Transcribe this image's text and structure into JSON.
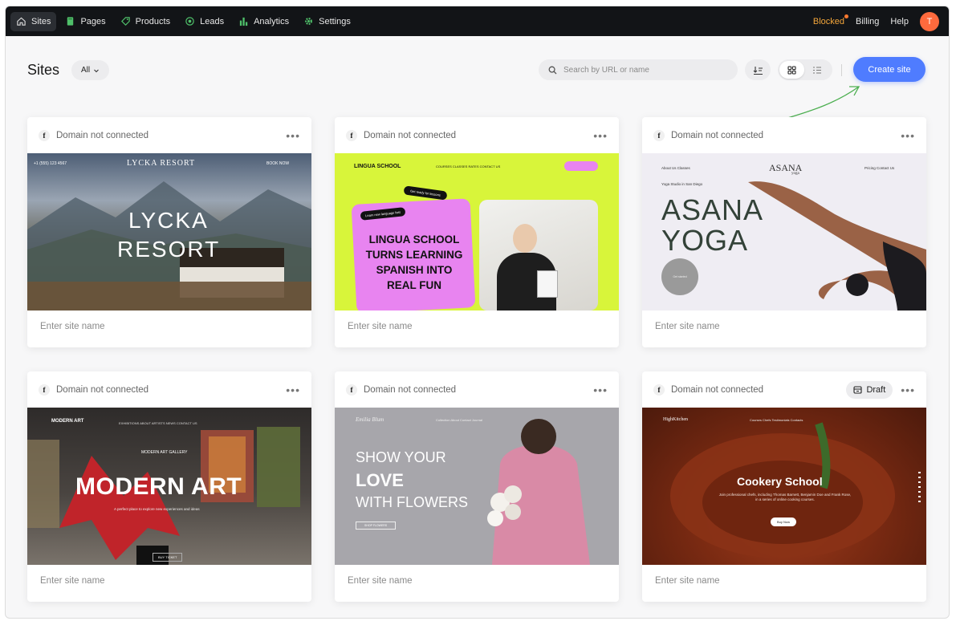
{
  "topbar": {
    "nav": [
      {
        "label": "Sites",
        "icon": "home-icon",
        "active": true
      },
      {
        "label": "Pages",
        "icon": "pages-icon"
      },
      {
        "label": "Products",
        "icon": "tag-icon"
      },
      {
        "label": "Leads",
        "icon": "target-icon"
      },
      {
        "label": "Analytics",
        "icon": "bar-chart-icon"
      },
      {
        "label": "Settings",
        "icon": "gear-icon"
      }
    ],
    "blocked_label": "Blocked",
    "billing_label": "Billing",
    "help_label": "Help",
    "avatar_initial": "T"
  },
  "header": {
    "title": "Sites",
    "filter_label": "All",
    "search_placeholder": "Search by URL or name",
    "create_label": "Create site"
  },
  "colors": {
    "accent": "#4f7cff",
    "topbar_bg": "#121417",
    "blocked": "#f2a53a",
    "avatar": "#ff6a3d"
  },
  "sites": [
    {
      "domain_status": "Domain not connected",
      "name_placeholder": "Enter site name",
      "preview": {
        "headline_1": "LYCKA",
        "headline_2": "RESORT",
        "brand": "LYCKA RESORT",
        "phone": "+1 (555) 123 4567",
        "cta": "BOOK NOW"
      }
    },
    {
      "domain_status": "Domain not connected",
      "name_placeholder": "Enter site name",
      "preview": {
        "brand": "LINGUA SCHOOL",
        "nav": "COURSES   CLASSES   RATES   CONTACT US",
        "headline": "LINGUA SCHOOL TURNS LEARNING SPANISH INTO REAL FUN",
        "tag_1": "Learn new language fast",
        "tag_2": "Get ready for lessons"
      }
    },
    {
      "domain_status": "Domain not connected",
      "name_placeholder": "Enter site name",
      "preview": {
        "logo": "ASANA",
        "logo_sub": "yoga",
        "nav_left": "About Us     Classes",
        "nav_right": "Pricing     Contact Us",
        "tagline": "Yoga Studio in San Diego",
        "headline_1": "ASANA",
        "headline_2": "YOGA",
        "circle": "Get started"
      }
    },
    {
      "domain_status": "Domain not connected",
      "name_placeholder": "Enter site name",
      "preview": {
        "logo": "MODERN ART",
        "nav": "EXHIBITIONS   ABOUT   ARTISTS   NEWS   CONTACT US",
        "kicker": "MODERN ART GALLERY",
        "headline": "MODERN ART",
        "sub": "A perfect place to explore new experiences and ideas",
        "cta": "BUY TICKET"
      }
    },
    {
      "domain_status": "Domain not connected",
      "name_placeholder": "Enter site name",
      "preview": {
        "logo": "Emilia Blum",
        "nav": "Collection    About    Contact    Journal",
        "line_1": "SHOW YOUR",
        "line_2": "LOVE",
        "line_3": "WITH FLOWERS",
        "cta": "SHOP FLOWERS"
      }
    },
    {
      "domain_status": "Domain not connected",
      "name_placeholder": "Enter site name",
      "draft_label": "Draft",
      "preview": {
        "logo": "HighKitchen",
        "nav": "Courses   Chefs   Testimonials   Contacts",
        "headline": "Cookery School",
        "sub": "Join professional chefs, including Thomas Barnett, Benjamin Doe and Frank Rose, in a series of online cooking courses.",
        "cta": "Buy Now"
      }
    }
  ]
}
